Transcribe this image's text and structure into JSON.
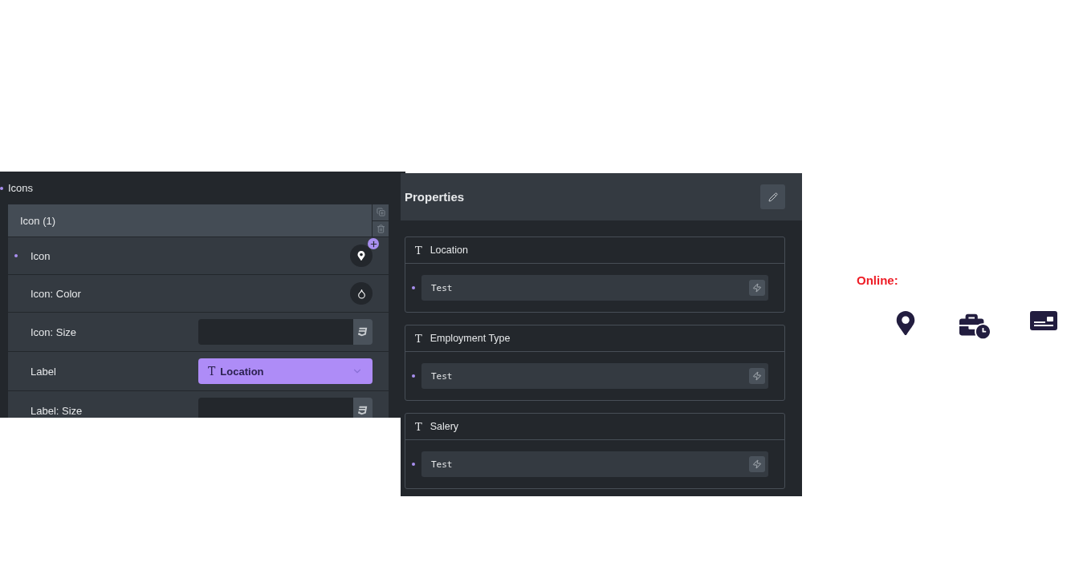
{
  "left_panel": {
    "section_title": "Icons",
    "repeater_item": {
      "title": "Icon (1)"
    },
    "controls": [
      {
        "kind": "icon",
        "label": "Icon",
        "dot": true
      },
      {
        "kind": "color",
        "label": "Icon: Color",
        "dot": false
      },
      {
        "kind": "number",
        "label": "Icon: Size",
        "dot": false
      },
      {
        "kind": "select",
        "label": "Label",
        "dot": false,
        "glyph": "T",
        "value": "Location"
      },
      {
        "kind": "number",
        "label": "Label: Size",
        "dot": false
      }
    ]
  },
  "properties": {
    "title": "Properties",
    "fields": [
      {
        "glyph": "T",
        "label": "Location",
        "value": "Test"
      },
      {
        "glyph": "T",
        "label": "Employment Type",
        "value": "Test"
      },
      {
        "glyph": "T",
        "label": "Salery",
        "value": "Test"
      }
    ]
  },
  "preview": {
    "heading": "Online:",
    "icons": [
      {
        "kind": "pin"
      },
      {
        "kind": "briefcase-clock"
      },
      {
        "kind": "card"
      }
    ]
  }
}
